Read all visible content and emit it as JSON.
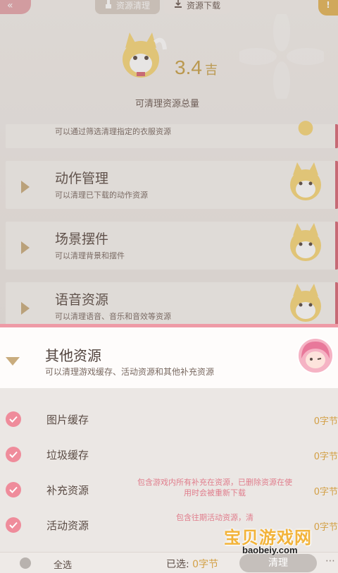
{
  "header": {
    "back_glyph": "«",
    "tabs": [
      {
        "label": "资源清理",
        "icon": "broom-icon",
        "active": true
      },
      {
        "label": "资源下载",
        "icon": "download-icon",
        "active": false
      }
    ],
    "help_glyph": "!"
  },
  "summary": {
    "amount": "3.4",
    "unit": "吉",
    "caption": "可清理资源总量"
  },
  "categories": [
    {
      "name": "",
      "desc": "可以通过筛选清理指定的衣服资源"
    },
    {
      "name": "动作管理",
      "desc": "可以清理已下载的动作资源"
    },
    {
      "name": "场景摆件",
      "desc": "可以清理背景和摆件"
    },
    {
      "name": "语音资源",
      "desc": "可以清理语音、音乐和音效等资源"
    }
  ],
  "expanded": {
    "title": "其他资源",
    "desc": "可以清理游戏缓存、活动资源和其他补充资源",
    "rows": [
      {
        "label": "图片缓存",
        "note": "",
        "size": "0字节"
      },
      {
        "label": "垃圾缓存",
        "note": "",
        "size": "0字节"
      },
      {
        "label": "补充资源",
        "note": "包含游戏内所有补充在资源，已删除资源在使用时会被重新下载",
        "size": "0字节"
      },
      {
        "label": "活动资源",
        "note": "包含往期活动资源，清",
        "size": "0字节"
      }
    ]
  },
  "bottom": {
    "select_all": "全选",
    "selected_label": "已选:",
    "selected_value": "0字节",
    "clean_button": "清理",
    "more": "⋯"
  },
  "watermark": {
    "text": "宝贝游戏网",
    "url": "baobeiy.com"
  },
  "colors": {
    "accent_pink": "#ef8c9b",
    "gold": "#d3a046",
    "arrow": "#c9ac7e"
  }
}
